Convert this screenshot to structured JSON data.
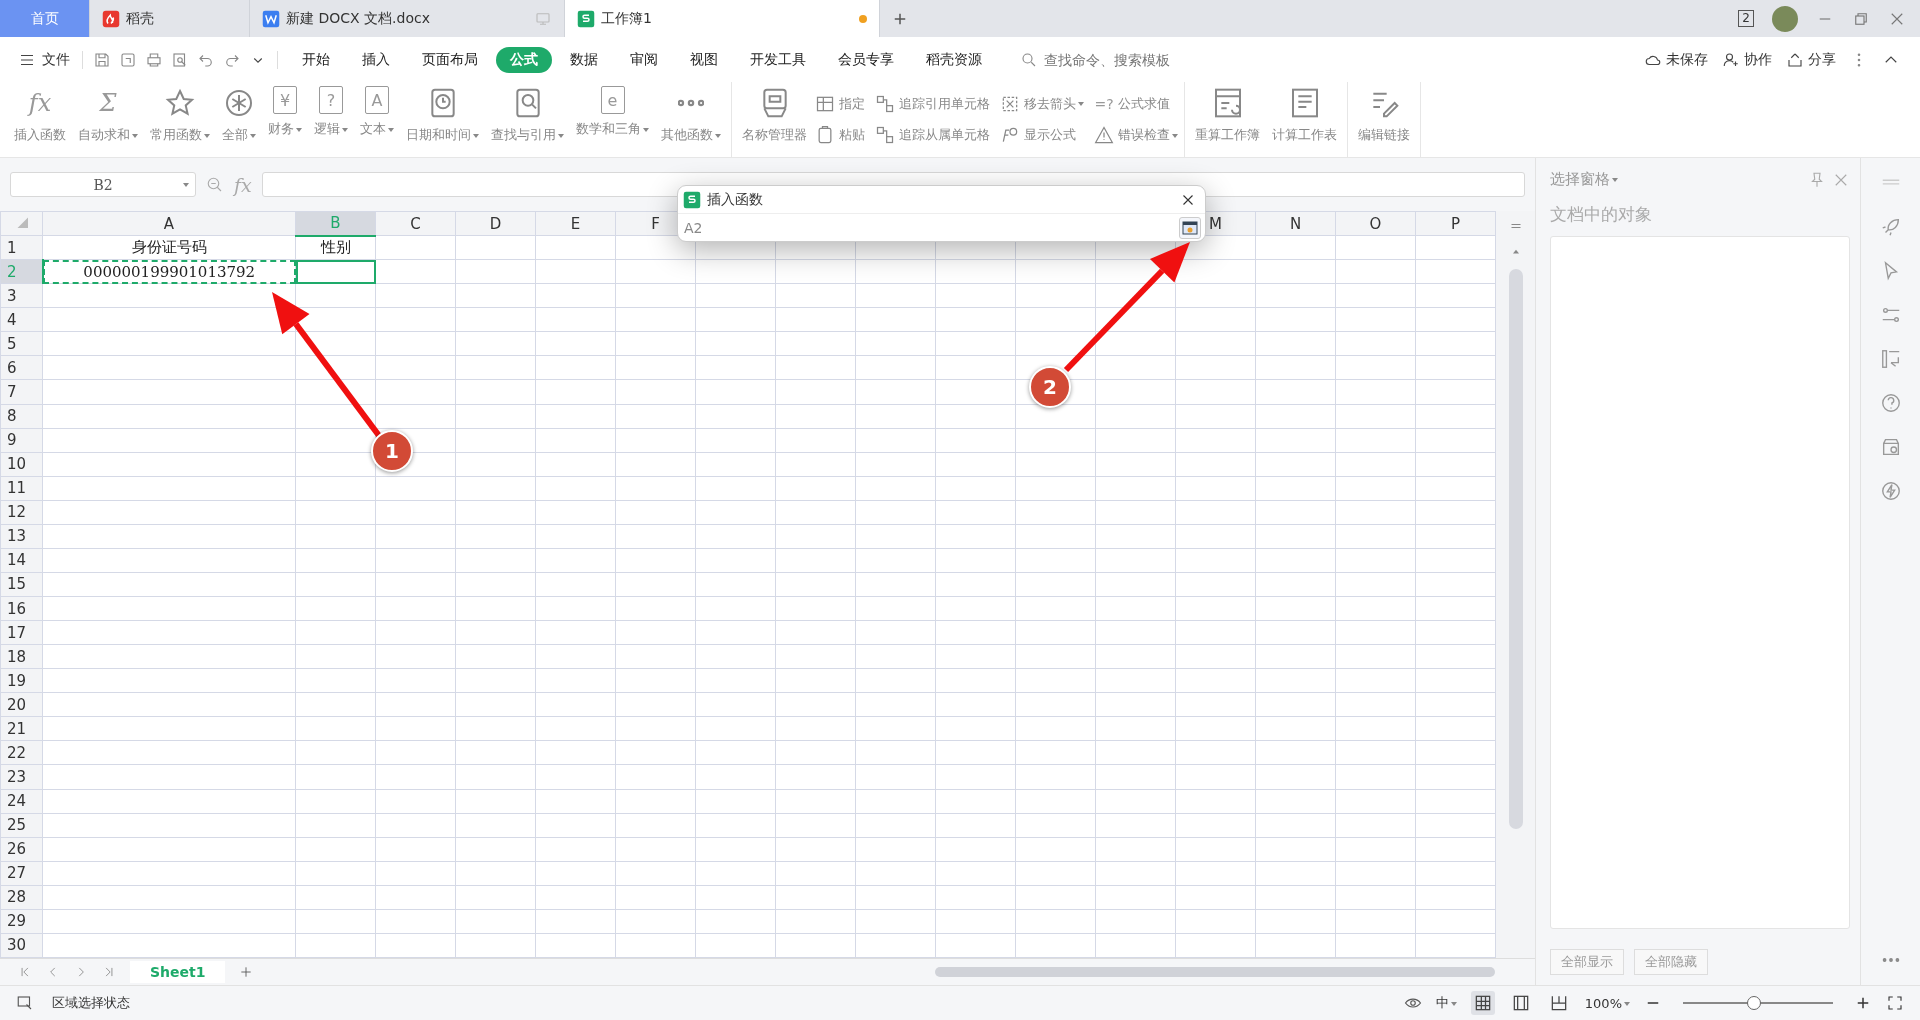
{
  "tabs": [
    {
      "kind": "home",
      "label": "首页",
      "selected": false,
      "modified": false
    },
    {
      "kind": "docer",
      "label": "稻壳",
      "selected": false,
      "modified": false
    },
    {
      "kind": "writer",
      "label": "新建 DOCX 文档.docx",
      "selected": false,
      "modified": false
    },
    {
      "kind": "spreadsheet",
      "label": "工作簿1",
      "selected": true,
      "modified": true
    }
  ],
  "window": {
    "badge": "2"
  },
  "menu": {
    "file": "文件",
    "items": [
      {
        "label": "开始",
        "selected": false
      },
      {
        "label": "插入",
        "selected": false
      },
      {
        "label": "页面布局",
        "selected": false
      },
      {
        "label": "公式",
        "selected": true
      },
      {
        "label": "数据",
        "selected": false
      },
      {
        "label": "审阅",
        "selected": false
      },
      {
        "label": "视图",
        "selected": false
      },
      {
        "label": "开发工具",
        "selected": false
      },
      {
        "label": "会员专享",
        "selected": false
      },
      {
        "label": "稻壳资源",
        "selected": false
      }
    ],
    "search": {
      "placeholder": "查找命令、搜索模板"
    },
    "actions": [
      {
        "kind": "cloud",
        "label": "未保存"
      },
      {
        "kind": "collab",
        "label": "协作"
      },
      {
        "kind": "share",
        "label": "分享"
      }
    ]
  },
  "ribbon": {
    "groups": [
      {
        "items": [
          {
            "kind": "large",
            "glyph": "fx",
            "label": "插入函数",
            "dropdown": false
          },
          {
            "kind": "large",
            "glyph": "Σ",
            "label": "自动求和",
            "dropdown": true
          },
          {
            "kind": "large",
            "label": "常用函数",
            "dropdown": true
          },
          {
            "kind": "large",
            "label": "全部",
            "dropdown": true
          },
          {
            "kind": "large",
            "glyph": "¥",
            "label": "财务",
            "dropdown": true
          },
          {
            "kind": "large",
            "glyph": "?",
            "label": "逻辑",
            "dropdown": true
          },
          {
            "kind": "large",
            "glyph": "A",
            "label": "文本",
            "dropdown": true
          },
          {
            "kind": "large",
            "label": "日期和时间",
            "dropdown": true
          },
          {
            "kind": "large",
            "label": "查找与引用",
            "dropdown": true
          },
          {
            "kind": "large",
            "glyph": "e",
            "label": "数学和三角",
            "dropdown": true
          },
          {
            "kind": "large",
            "label": "其他函数",
            "dropdown": true
          }
        ]
      },
      {
        "items": [
          {
            "kind": "large",
            "label": "名称管理器",
            "dropdown": false
          },
          {
            "kind": "small",
            "label": "指定",
            "dropdown": false
          },
          {
            "kind": "small",
            "label": "粘贴",
            "dropdown": false
          },
          {
            "kind": "small",
            "label": "追踪引用单元格",
            "dropdown": false
          },
          {
            "kind": "small",
            "label": "追踪从属单元格",
            "dropdown": false
          },
          {
            "kind": "small",
            "label": "移去箭头",
            "dropdown": true
          },
          {
            "kind": "small",
            "label": "显示公式",
            "dropdown": false
          },
          {
            "kind": "small",
            "glyph": "=?",
            "label": "公式求值",
            "dropdown": false
          },
          {
            "kind": "small",
            "label": "错误检查",
            "dropdown": true
          }
        ]
      },
      {
        "items": [
          {
            "kind": "large",
            "label": "重算工作簿",
            "dropdown": false
          },
          {
            "kind": "large",
            "label": "计算工作表",
            "dropdown": false
          }
        ]
      },
      {
        "items": [
          {
            "kind": "large",
            "label": "编辑链接",
            "dropdown": false
          }
        ]
      }
    ]
  },
  "name_box": "B2",
  "formula_label": "fx",
  "grid": {
    "columns": [
      {
        "label": "A",
        "selected": false,
        "gap_before": false
      },
      {
        "label": "B",
        "selected": true,
        "gap_before": false
      },
      {
        "label": "C",
        "selected": false,
        "gap_before": false
      },
      {
        "label": "D",
        "selected": false,
        "gap_before": false
      },
      {
        "label": "E",
        "selected": false,
        "gap_before": false
      },
      {
        "label": "F",
        "selected": false,
        "gap_before": false
      },
      {
        "label": "M",
        "selected": false,
        "gap_before": true
      },
      {
        "label": "N",
        "selected": false,
        "gap_before": false
      },
      {
        "label": "O",
        "selected": false,
        "gap_before": false
      },
      {
        "label": "P",
        "selected": false,
        "gap_before": false
      }
    ],
    "rows": [
      {
        "header": "1",
        "selected": false,
        "cells": [
          {
            "text": "身份证号码",
            "copied": false
          },
          {
            "text": "性别",
            "copied": false
          }
        ]
      },
      {
        "header": "2",
        "selected": true,
        "cells": [
          {
            "text": "000000199901013792",
            "copied": true
          }
        ]
      },
      {
        "header": "3",
        "selected": false
      },
      {
        "header": "4",
        "selected": false
      },
      {
        "header": "5",
        "selected": false
      },
      {
        "header": "6",
        "selected": false
      },
      {
        "header": "7",
        "selected": false
      },
      {
        "header": "8",
        "selected": false
      },
      {
        "header": "9",
        "selected": false
      },
      {
        "header": "10",
        "selected": false
      },
      {
        "header": "11",
        "selected": false
      },
      {
        "header": "12",
        "selected": false
      },
      {
        "header": "13",
        "selected": false
      },
      {
        "header": "14",
        "selected": false
      },
      {
        "header": "15",
        "selected": false
      },
      {
        "header": "16",
        "selected": false
      },
      {
        "header": "17",
        "selected": false
      },
      {
        "header": "18",
        "selected": false
      },
      {
        "header": "19",
        "selected": false
      },
      {
        "header": "20",
        "selected": false
      },
      {
        "header": "21",
        "selected": false
      },
      {
        "header": "22",
        "selected": false
      },
      {
        "header": "23",
        "selected": false
      },
      {
        "header": "24",
        "selected": false
      },
      {
        "header": "25",
        "selected": false
      },
      {
        "header": "26",
        "selected": false
      },
      {
        "header": "27",
        "selected": false
      },
      {
        "header": "28",
        "selected": false
      },
      {
        "header": "29",
        "selected": false
      },
      {
        "header": "30",
        "selected": false
      }
    ]
  },
  "dialog": {
    "title": "插入函数",
    "value": "A2"
  },
  "annotations": [
    {
      "label": "1"
    },
    {
      "label": "2"
    }
  ],
  "selection_pane": {
    "title": "选择窗格",
    "subtitle": "文档中的对象",
    "buttons": [
      "全部显示",
      "全部隐藏"
    ]
  },
  "sheet_tabs": [
    {
      "label": "Sheet1",
      "selected": true
    }
  ],
  "status_bar": {
    "text": "区域选择状态",
    "input_mode": "中",
    "views": [
      {
        "kind": "normal",
        "selected": true
      },
      {
        "kind": "layout",
        "selected": false
      },
      {
        "kind": "pagebreak",
        "selected": false
      }
    ],
    "zoom": "100%",
    "zoom_slider": {
      "level": 0.47
    }
  }
}
